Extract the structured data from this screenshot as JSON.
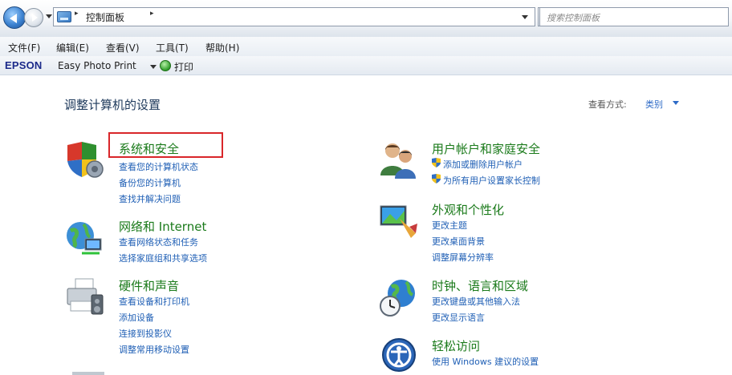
{
  "address_bar": {
    "breadcrumb": "控制面板",
    "separator": "▸",
    "search_placeholder": "搜索控制面板"
  },
  "menu": {
    "items": [
      "文件(F)",
      "编辑(E)",
      "查看(V)",
      "工具(T)",
      "帮助(H)"
    ]
  },
  "epson": {
    "brand": "EPSON",
    "app_label": "Easy Photo Print",
    "print_label": "打印"
  },
  "content": {
    "title": "调整计算机的设置",
    "view_by_label": "查看方式:",
    "view_by_value": "类别"
  },
  "categories": [
    {
      "title": "系统和安全",
      "links": [
        "查看您的计算机状态",
        "备份您的计算机",
        "查找并解决问题"
      ]
    },
    {
      "title": "网络和 Internet",
      "links": [
        "查看网络状态和任务",
        "选择家庭组和共享选项"
      ]
    },
    {
      "title": "硬件和声音",
      "links": [
        "查看设备和打印机",
        "添加设备",
        "连接到投影仪",
        "调整常用移动设置"
      ]
    },
    {
      "title": "用户帐户和家庭安全",
      "links": [
        "添加或删除用户帐户",
        "为所有用户设置家长控制"
      ]
    },
    {
      "title": "外观和个性化",
      "links": [
        "更改主题",
        "更改桌面背景",
        "调整屏幕分辨率"
      ]
    },
    {
      "title": "时钟、语言和区域",
      "links": [
        "更改键盘或其他输入法",
        "更改显示语言"
      ]
    },
    {
      "title": "轻松访问",
      "links": [
        "使用 Windows 建议的设置",
        ""
      ]
    }
  ],
  "colors": {
    "category_title": "#1a7a1a",
    "link": "#1f5fb5",
    "highlight_border": "#d9262a"
  }
}
